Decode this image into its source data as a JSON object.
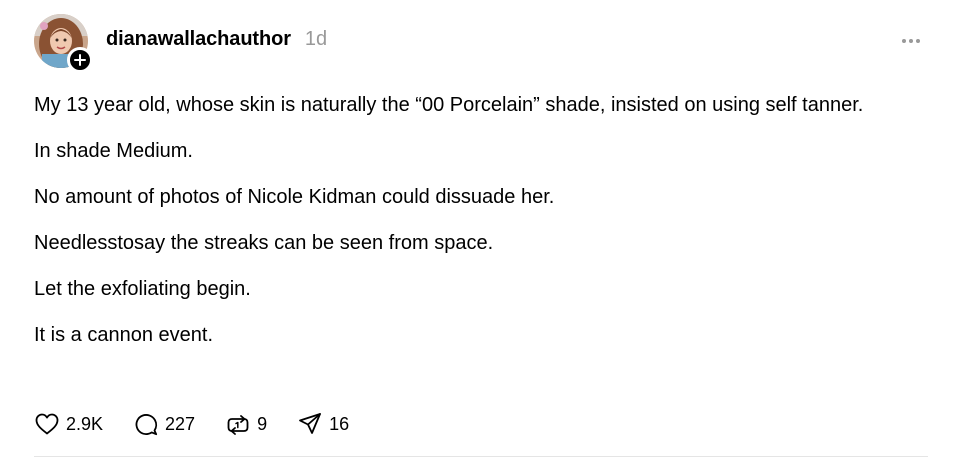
{
  "post": {
    "username": "dianawallachauthor",
    "timestamp": "1d",
    "paragraphs": [
      "My 13 year old, whose skin is naturally the “00 Porcelain” shade, insisted on using self tanner.",
      "In shade Medium.",
      "No amount of photos of Nicole Kidman could dissuade her.",
      "Needlesstosay the streaks can be seen from space.",
      "Let the exfoliating begin.",
      "It is a cannon event."
    ]
  },
  "actions": {
    "likes": "2.9K",
    "comments": "227",
    "reposts": "9",
    "shares": "16"
  },
  "icons": {
    "avatar": "avatar-photo",
    "follow": "plus-icon",
    "more": "more-options-icon",
    "like": "heart-icon",
    "comment": "comment-bubble-icon",
    "repost": "repost-icon",
    "share": "send-icon"
  },
  "colors": {
    "text": "#000000",
    "secondary": "#999999",
    "divider": "#e5e5e5"
  }
}
